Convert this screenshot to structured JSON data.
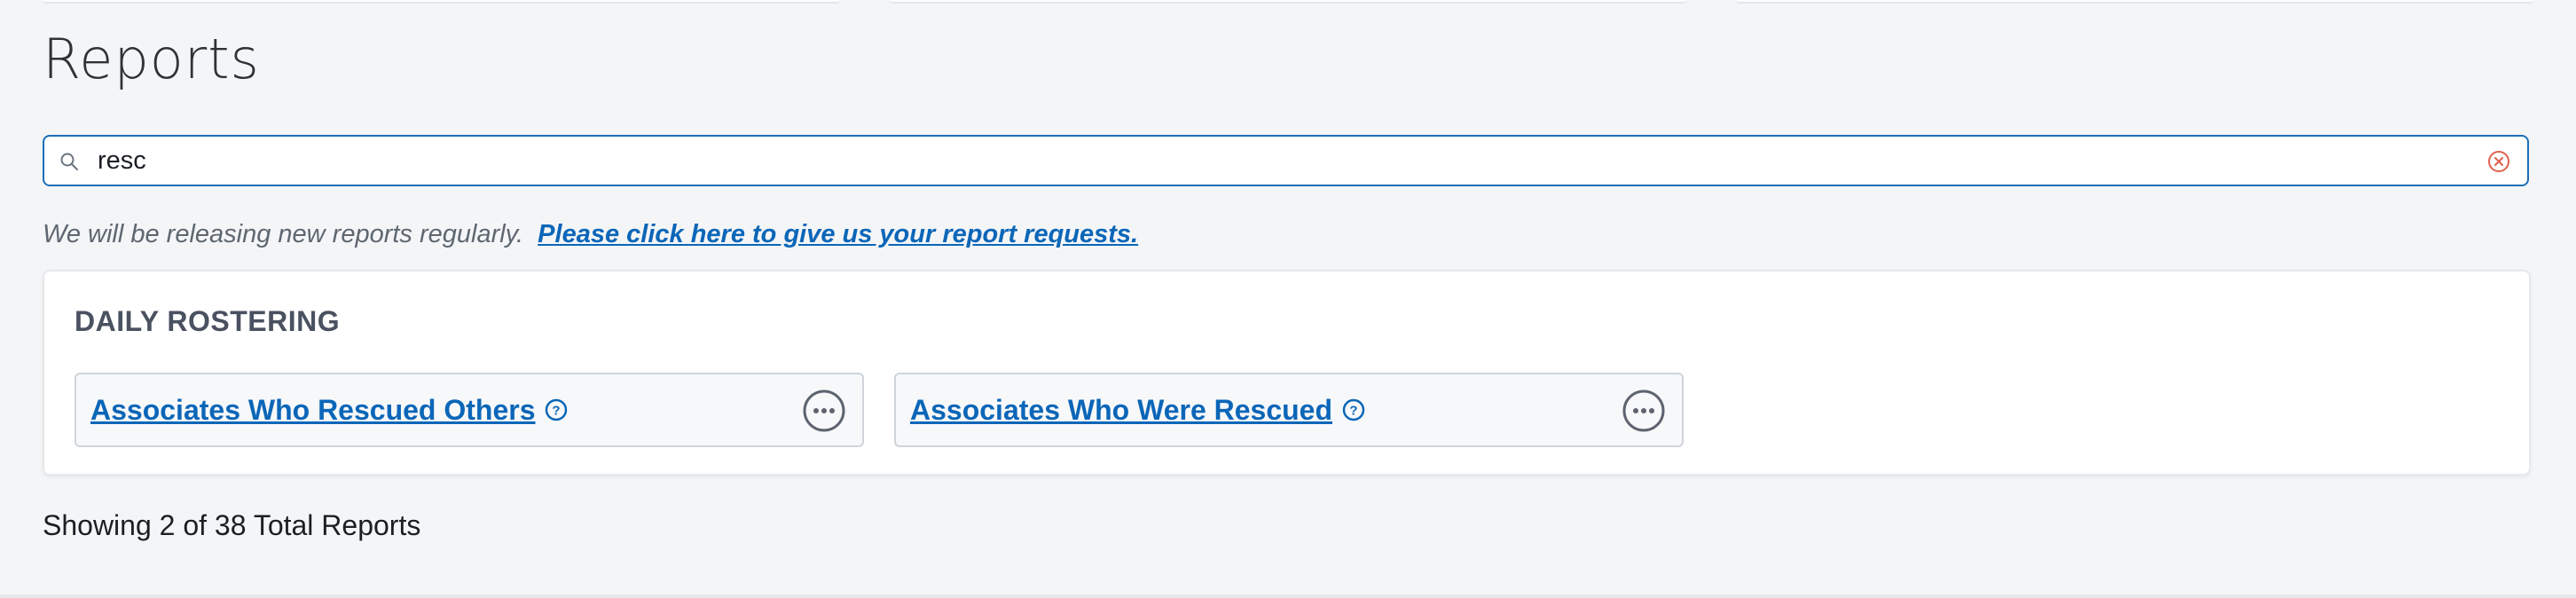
{
  "page": {
    "title": "Reports"
  },
  "search": {
    "value": "resc",
    "placeholder": ""
  },
  "notice": {
    "text": "We will be releasing new reports regularly.",
    "link_label": "Please click here to give us your report requests."
  },
  "categories": [
    {
      "title": "DAILY ROSTERING",
      "reports": [
        {
          "label": "Associates Who Rescued Others"
        },
        {
          "label": "Associates Who Were Rescued"
        }
      ]
    }
  ],
  "summary": {
    "text": "Showing 2 of 38 Total Reports"
  },
  "icons": {
    "search": "search-icon",
    "clear": "clear-circle-x-icon",
    "help": "question-circle-icon",
    "more": "ellipsis-circle-icon"
  },
  "colors": {
    "accent": "#0b66b8",
    "focus_border": "#1a6fb7",
    "clear_icon": "#e0604f",
    "heading": "#4a5160",
    "background": "#f4f5f7"
  }
}
